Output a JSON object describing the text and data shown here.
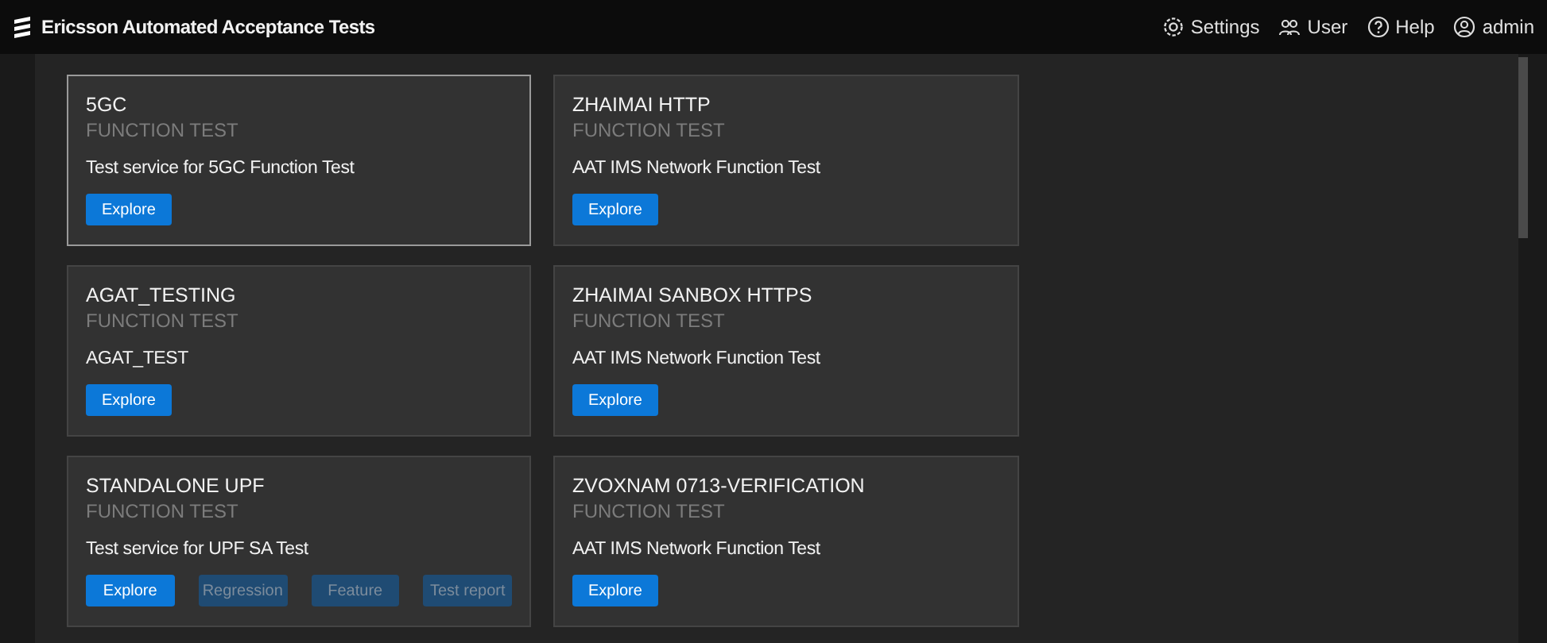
{
  "header": {
    "title": "Ericsson Automated Acceptance Tests",
    "menu": [
      {
        "kind": "settings",
        "label": "Settings"
      },
      {
        "kind": "user",
        "label": "User"
      },
      {
        "kind": "help",
        "label": "Help"
      },
      {
        "kind": "account",
        "label": "admin"
      }
    ]
  },
  "cards": [
    {
      "title": "5GC",
      "subtitle": "FUNCTION TEST",
      "description": "Test service for 5GC Function Test",
      "selected": true,
      "buttons": [
        {
          "label": "Explore",
          "disabled": false
        }
      ]
    },
    {
      "title": "ZHAIMAI HTTP",
      "subtitle": "FUNCTION TEST",
      "description": "AAT IMS Network Function Test",
      "selected": false,
      "buttons": [
        {
          "label": "Explore",
          "disabled": false
        }
      ]
    },
    {
      "title": "AGAT_TESTING",
      "subtitle": "FUNCTION TEST",
      "description": "AGAT_TEST",
      "selected": false,
      "buttons": [
        {
          "label": "Explore",
          "disabled": false
        }
      ]
    },
    {
      "title": "ZHAIMAI SANBOX HTTPS",
      "subtitle": "FUNCTION TEST",
      "description": "AAT IMS Network Function Test",
      "selected": false,
      "buttons": [
        {
          "label": "Explore",
          "disabled": false
        }
      ]
    },
    {
      "title": "STANDALONE UPF",
      "subtitle": "FUNCTION TEST",
      "description": "Test service for UPF SA Test",
      "selected": false,
      "buttons": [
        {
          "label": "Explore",
          "disabled": false
        },
        {
          "label": "Regression",
          "disabled": true
        },
        {
          "label": "Feature",
          "disabled": true
        },
        {
          "label": "Test report",
          "disabled": true
        }
      ]
    },
    {
      "title": "ZVOXNAM 0713-VERIFICATION",
      "subtitle": "FUNCTION TEST",
      "description": "AAT IMS Network Function Test",
      "selected": false,
      "buttons": [
        {
          "label": "Explore",
          "disabled": false
        }
      ]
    }
  ]
}
